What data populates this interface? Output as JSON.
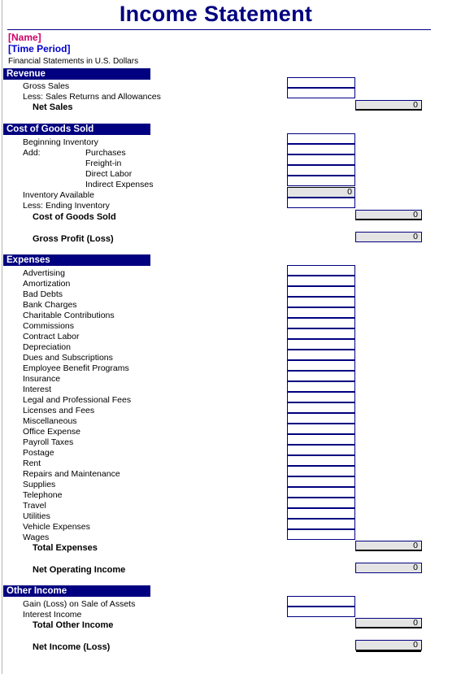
{
  "document": {
    "title": "Income Statement",
    "company_name": "[Name]",
    "time_period": "[Time Period]",
    "currency_note": "Financial Statements in U.S. Dollars"
  },
  "colors": {
    "title": "#000080",
    "section_bar": "#000080",
    "name": "#cc0066",
    "period": "#0000cc",
    "cell_border": "#000080",
    "total_fill": "#e4e4e4"
  },
  "sections": {
    "revenue": {
      "heading": "Revenue",
      "rows": [
        {
          "label": "Gross Sales",
          "value": ""
        },
        {
          "label": "Less: Sales Returns and Allowances",
          "value": ""
        }
      ],
      "total": {
        "label": "Net Sales",
        "value": "0"
      }
    },
    "cogs": {
      "heading": "Cost of Goods Sold",
      "rows": [
        {
          "label": "Beginning Inventory",
          "value": ""
        },
        {
          "label": "Add:",
          "sublabel": "Purchases",
          "value": ""
        },
        {
          "label": "",
          "sublabel": "Freight-in",
          "value": ""
        },
        {
          "label": "",
          "sublabel": "Direct Labor",
          "value": ""
        },
        {
          "label": "",
          "sublabel": "Indirect Expenses",
          "value": ""
        }
      ],
      "subtotal": {
        "label": "Inventory Available",
        "value": "0"
      },
      "less_row": {
        "label": "Less: Ending Inventory",
        "value": ""
      },
      "total": {
        "label": "Cost of Goods Sold",
        "value": "0"
      },
      "gross_profit": {
        "label": "Gross Profit (Loss)",
        "value": "0"
      }
    },
    "expenses": {
      "heading": "Expenses",
      "rows": [
        {
          "label": "Advertising",
          "value": ""
        },
        {
          "label": "Amortization",
          "value": ""
        },
        {
          "label": "Bad Debts",
          "value": ""
        },
        {
          "label": "Bank Charges",
          "value": ""
        },
        {
          "label": "Charitable Contributions",
          "value": ""
        },
        {
          "label": "Commissions",
          "value": ""
        },
        {
          "label": "Contract Labor",
          "value": ""
        },
        {
          "label": "Depreciation",
          "value": ""
        },
        {
          "label": "Dues and Subscriptions",
          "value": ""
        },
        {
          "label": "Employee Benefit Programs",
          "value": ""
        },
        {
          "label": "Insurance",
          "value": ""
        },
        {
          "label": "Interest",
          "value": ""
        },
        {
          "label": "Legal and Professional Fees",
          "value": ""
        },
        {
          "label": "Licenses and Fees",
          "value": ""
        },
        {
          "label": "Miscellaneous",
          "value": ""
        },
        {
          "label": "Office Expense",
          "value": ""
        },
        {
          "label": "Payroll Taxes",
          "value": ""
        },
        {
          "label": "Postage",
          "value": ""
        },
        {
          "label": "Rent",
          "value": ""
        },
        {
          "label": "Repairs and Maintenance",
          "value": ""
        },
        {
          "label": "Supplies",
          "value": ""
        },
        {
          "label": "Telephone",
          "value": ""
        },
        {
          "label": "Travel",
          "value": ""
        },
        {
          "label": "Utilities",
          "value": ""
        },
        {
          "label": "Vehicle Expenses",
          "value": ""
        },
        {
          "label": "Wages",
          "value": ""
        }
      ],
      "total": {
        "label": "Total Expenses",
        "value": "0"
      },
      "net_operating_income": {
        "label": "Net Operating Income",
        "value": "0"
      }
    },
    "other_income": {
      "heading": "Other Income",
      "rows": [
        {
          "label": "Gain (Loss) on Sale of Assets",
          "value": ""
        },
        {
          "label": "Interest Income",
          "value": ""
        }
      ],
      "total": {
        "label": "Total Other Income",
        "value": "0"
      },
      "net_income": {
        "label": "Net Income (Loss)",
        "value": "0"
      }
    }
  }
}
